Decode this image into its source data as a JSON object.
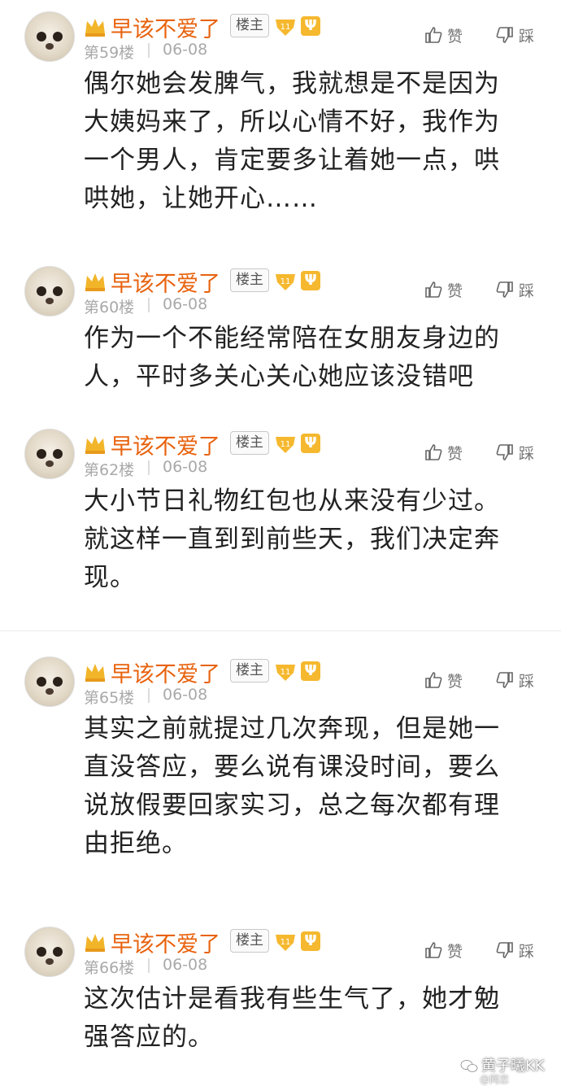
{
  "posts": [
    {
      "user": "早该不爱了",
      "badge": "楼主",
      "level": "11",
      "vip": "Ψ",
      "floor": "第59楼",
      "date": "06-08",
      "like": "赞",
      "dislike": "踩",
      "lines": [
        "偶尔她会发脾气，我就想是不是因为",
        "大姨妈来了，所以心情不好，我作为",
        "一个男人，肯定要多让着她一点，哄",
        "哄她，让她开心……"
      ]
    },
    {
      "user": "早该不爱了",
      "badge": "楼主",
      "level": "11",
      "vip": "Ψ",
      "floor": "第60楼",
      "date": "06-08",
      "like": "赞",
      "dislike": "踩",
      "lines": [
        "作为一个不能经常陪在女朋友身边的",
        "人，平时多关心关心她应该没错吧"
      ]
    },
    {
      "user": "早该不爱了",
      "badge": "楼主",
      "level": "11",
      "vip": "Ψ",
      "floor": "第62楼",
      "date": "06-08",
      "like": "赞",
      "dislike": "踩",
      "lines": [
        "大小节日礼物红包也从来没有少过。",
        "就这样一直到到前些天，我们决定奔",
        "现。"
      ]
    },
    {
      "user": "早该不爱了",
      "badge": "楼主",
      "level": "11",
      "vip": "Ψ",
      "floor": "第65楼",
      "date": "06-08",
      "like": "赞",
      "dislike": "踩",
      "lines": [
        "其实之前就提过几次奔现，但是她一",
        "直没答应，要么说有课没时间，要么",
        "说放假要回家实习，总之每次都有理",
        "由拒绝。"
      ]
    },
    {
      "user": "早该不爱了",
      "badge": "楼主",
      "level": "11",
      "vip": "Ψ",
      "floor": "第66楼",
      "date": "06-08",
      "like": "赞",
      "dislike": "踩",
      "lines": [
        "这次估计是看我有些生气了，她才勉",
        "强答应的。"
      ]
    }
  ],
  "watermark": {
    "main": "黄子曦KK",
    "sub": "@网恋"
  },
  "colors": {
    "username": "#e8620d",
    "meta": "#a9a9a9",
    "text": "#222222",
    "vip": "#f5b82e"
  }
}
